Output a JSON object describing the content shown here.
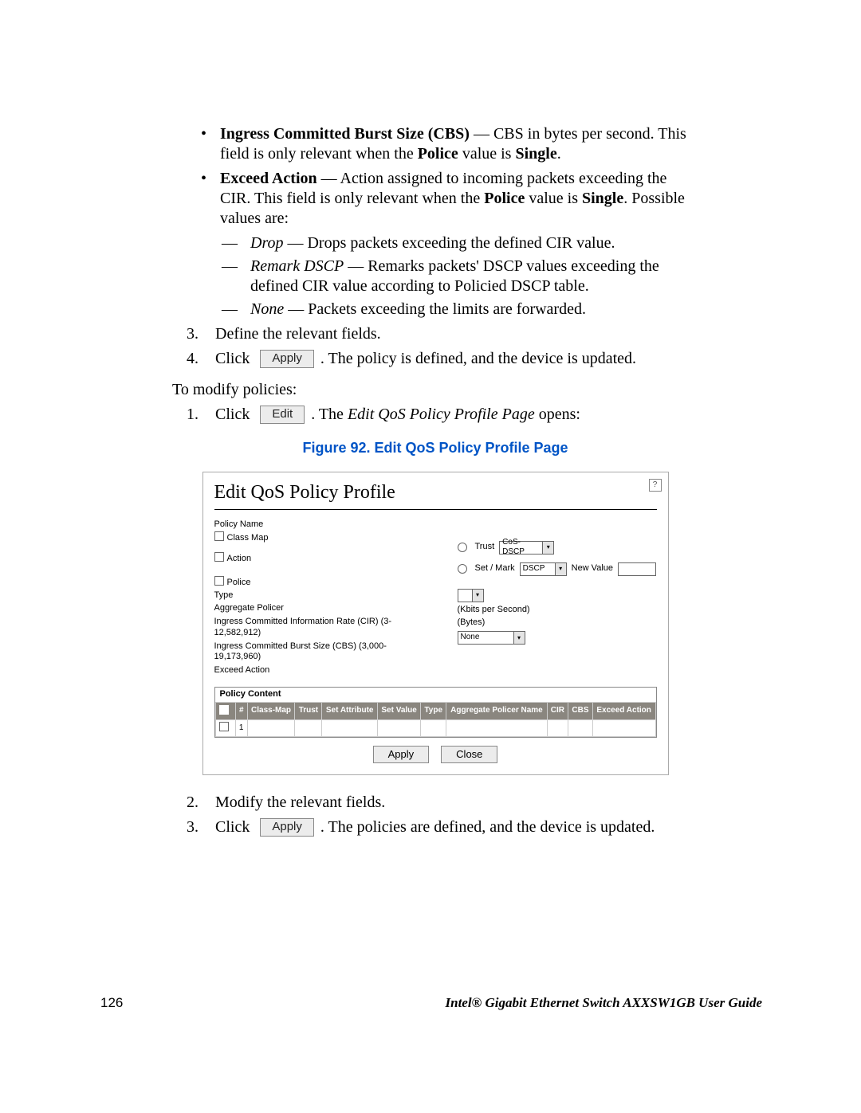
{
  "bullets": {
    "cbs_label": "Ingress Committed Burst Size (CBS)",
    "cbs_text": " — CBS in bytes per second. This field is only relevant when the ",
    "cbs_bold1": "Police",
    "cbs_text2": " value is ",
    "cbs_bold2": "Single",
    "cbs_text3": ".",
    "ea_label": "Exceed Action",
    "ea_text": " — Action assigned to incoming packets exceeding the CIR. This field is only relevant when the ",
    "ea_bold1": "Police",
    "ea_text2": " value is ",
    "ea_bold2": "Single",
    "ea_text3": ". Possible values are:"
  },
  "ea_opts": {
    "drop_em": "Drop",
    "drop_txt": " — Drops packets exceeding the defined CIR value.",
    "remark_em": "Remark DSCP",
    "remark_txt": " — Remarks packets' DSCP values exceeding the defined CIR value according to Policied DSCP table.",
    "none_em": "None",
    "none_txt": " — Packets exceeding the limits are forwarded."
  },
  "stepsA": {
    "s3": "Define the relevant fields.",
    "s4_a": "Click ",
    "s4_btn": "Apply",
    "s4_b": ". The policy is defined, and the device is updated."
  },
  "modify_intro": "To modify policies:",
  "stepsB": {
    "s1_a": "Click ",
    "s1_btn": "Edit",
    "s1_b": ". The ",
    "s1_em": "Edit QoS Policy Profile Page",
    "s1_c": " opens:"
  },
  "caption": "Figure 92. Edit QoS Policy Profile Page",
  "dlg": {
    "title": "Edit QoS Policy Profile",
    "help": "?",
    "policy_name": "Policy Name",
    "class_map": "Class Map",
    "action": "Action",
    "police": "Police",
    "type": "Type",
    "agg": "Aggregate Policer",
    "cir_lbl": "Ingress Committed Information Rate (CIR) (3-12,582,912)",
    "cir_unit": "(Kbits per Second)",
    "cbs_lbl": "Ingress Committed Burst Size (CBS) (3,000-19,173,960)",
    "cbs_unit": "(Bytes)",
    "exceed_lbl": "Exceed Action",
    "exceed_sel": "None",
    "trust": "Trust",
    "trust_sel": "CoS-DSCP",
    "setmark": "Set / Mark",
    "setmark_sel": "DSCP",
    "newval": "New Value",
    "pc_head": "Policy Content",
    "th": {
      "c1": "#",
      "c2": "Class-Map",
      "c3": "Trust",
      "c4": "Set Attribute",
      "c5": "Set Value",
      "c6": "Type",
      "c7": "Aggregate Policer Name",
      "c8": "CIR",
      "c9": "CBS",
      "c10": "Exceed Action"
    },
    "row1": "1",
    "apply": "Apply",
    "close": "Close"
  },
  "stepsC": {
    "s2": "Modify the relevant fields.",
    "s3_a": "Click ",
    "s3_btn": "Apply",
    "s3_b": ". The policies are defined, and the device is updated."
  },
  "footer": {
    "page": "126",
    "doc": "Intel® Gigabit Ethernet Switch AXXSW1GB User Guide"
  }
}
